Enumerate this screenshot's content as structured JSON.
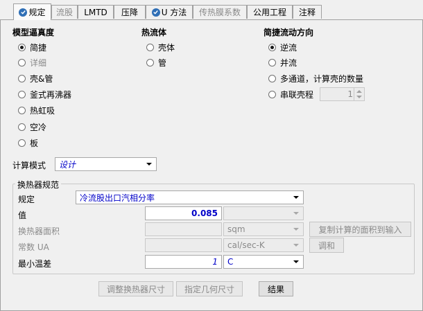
{
  "tabs": [
    {
      "label": "规定",
      "checked": true,
      "active": true,
      "enabled": true
    },
    {
      "label": "流股",
      "checked": false,
      "active": false,
      "enabled": false
    },
    {
      "label": "LMTD",
      "checked": false,
      "active": false,
      "enabled": true
    },
    {
      "label": "压降",
      "checked": false,
      "active": false,
      "enabled": true
    },
    {
      "label": "U 方法",
      "checked": true,
      "active": false,
      "enabled": true
    },
    {
      "label": "传热膜系数",
      "checked": false,
      "active": false,
      "enabled": false
    },
    {
      "label": "公用工程",
      "checked": false,
      "active": false,
      "enabled": true
    },
    {
      "label": "注释",
      "checked": false,
      "active": false,
      "enabled": true
    }
  ],
  "fidelity": {
    "title": "模型逼真度",
    "options": [
      "简捷",
      "详细",
      "壳&管",
      "釜式再沸器",
      "热虹吸",
      "空冷",
      "板"
    ],
    "selected": "简捷"
  },
  "hotfluid": {
    "title": "热流体",
    "options": [
      "壳体",
      "管"
    ]
  },
  "flow": {
    "title": "简捷流动方向",
    "options": [
      "逆流",
      "并流",
      "多通道，计算壳的数量",
      "串联壳程"
    ],
    "selected": "逆流",
    "series_shells_value": "1"
  },
  "calc_mode": {
    "label": "计算模式",
    "value": "设计"
  },
  "spec": {
    "group_title": "换热器规范",
    "spec_label": "规定",
    "spec_value": "冷流股出口汽相分率",
    "value_label": "值",
    "value": "0.085",
    "area_label": "换热器面积",
    "area_unit": "sqm",
    "ua_label": "常数 UA",
    "ua_unit": "cal/sec-K",
    "min_dt_label": "最小温差",
    "min_dt_value": "1",
    "min_dt_unit": "C",
    "copy_area_button": "复制计算的面积到输入",
    "adjust_button": "调和"
  },
  "bottom": {
    "size_button": "调整换热器尺寸",
    "geom_button": "指定几何尺寸",
    "results_button": "结果"
  },
  "colors": {
    "accent": "#2f6fb6",
    "value_blue": "#0000c8"
  }
}
